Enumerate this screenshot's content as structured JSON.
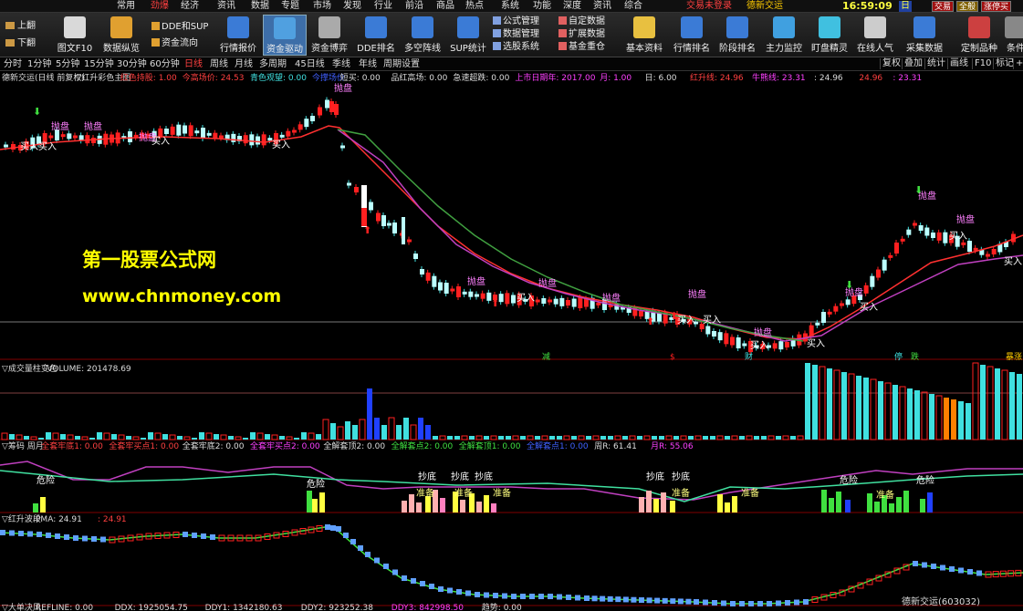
{
  "menu": {
    "items": [
      "常用",
      "劲爆",
      "经济",
      "资讯",
      "数据",
      "专题",
      "市场",
      "发现",
      "行业",
      "前沿",
      "商品",
      "热点",
      "系统",
      "功能",
      "深度",
      "资讯",
      "综合"
    ],
    "active": "劲爆",
    "status_red": "交易未登录",
    "status_gold": "德新交运",
    "clock": "16:59:09",
    "day": "日",
    "right_buttons": [
      "交易",
      "全般",
      "涨停买"
    ]
  },
  "toolbar": {
    "side_buttons": [
      "上翻",
      "下翻"
    ],
    "buttons": [
      {
        "label": "图文F10",
        "color": "#d9d9d9"
      },
      {
        "label": "数据纵览",
        "color": "#e0a030"
      },
      {
        "label": "行情报价",
        "color": "#3b7bd6"
      },
      {
        "label": "资金驱动",
        "color": "#50a0e0"
      },
      {
        "label": "资金博弈",
        "color": "#aaaaaa"
      },
      {
        "label": "DDE排名",
        "color": "#3b7bd6"
      },
      {
        "label": "多空阵线",
        "color": "#3b7bd6"
      },
      {
        "label": "SUP统计",
        "color": "#3b7bd6"
      },
      {
        "label": "基本资料",
        "color": "#e8c040"
      },
      {
        "label": "行情排名",
        "color": "#3b7bd6"
      },
      {
        "label": "阶段排名",
        "color": "#3b7bd6"
      },
      {
        "label": "主力监控",
        "color": "#40a0e0"
      },
      {
        "label": "盯盘精灵",
        "color": "#40c0e0"
      },
      {
        "label": "在线人气",
        "color": "#cccccc"
      },
      {
        "label": "采集数据",
        "color": "#3b7bd6"
      },
      {
        "label": "定制品种",
        "color": "#cc4040"
      },
      {
        "label": "条件",
        "color": "#888888"
      }
    ],
    "selected": "资金驱动",
    "mini_left": [
      "DDE和SUP",
      "资金流向"
    ],
    "mini_right_a": [
      "公式管理",
      "数据管理",
      "选股系统"
    ],
    "mini_right_b": [
      "自定数据",
      "扩展数据",
      "基金重仓"
    ]
  },
  "periods": {
    "items": [
      "分时",
      "1分钟",
      "5分钟",
      "15分钟",
      "30分钟",
      "60分钟",
      "日线",
      "周线",
      "月线",
      "多周期",
      "45日线",
      "季线",
      "年线",
      "周期设置"
    ],
    "active": "日线",
    "right": [
      "复权",
      "叠加",
      "统计",
      "画线",
      "F10",
      "标记",
      "+自"
    ]
  },
  "main_header": [
    {
      "t": "德新交运(日线 前复权)",
      "c": "#dddddd"
    },
    {
      "t": "▽红升彩色主图",
      "c": "#dddddd"
    },
    {
      "t": "红色持股: 1.00",
      "c": "#ff4040"
    },
    {
      "t": "今高场价: 24.53",
      "c": "#ff4040"
    },
    {
      "t": "青色观望: 0.00",
      "c": "#40e0e0"
    },
    {
      "t": "今撑场价",
      "c": "#4060ff"
    },
    {
      "t": "短买: 0.00",
      "c": "#dddddd"
    },
    {
      "t": "品红高场: 0.00",
      "c": "#dddddd"
    },
    {
      "t": "急速超跌: 0.00",
      "c": "#dddddd"
    },
    {
      "t": "上市日期年: 2017.00",
      "c": "#ff40ff"
    },
    {
      "t": "月: 1.00",
      "c": "#ff40ff"
    },
    {
      "t": "日: 6.00",
      "c": "#dddddd"
    },
    {
      "t": "红升线: 24.96",
      "c": "#ff4040"
    },
    {
      "t": "牛熊线: 23.31",
      "c": "#ff40ff"
    },
    {
      "t": ": 24.96",
      "c": "#dddddd"
    },
    {
      "t": "24.96",
      "c": "#ff4040"
    },
    {
      "t": ": 23.31",
      "c": "#ff40ff"
    }
  ],
  "watermark": {
    "line1": "第一股票公式网",
    "line2": "www.chnmoney.com"
  },
  "main_labels": {
    "sell": "抛盘",
    "buy": "买入",
    "shortsell": "减",
    "bottom_markers": [
      "减",
      "$",
      "财",
      "停",
      "跌",
      "暴涨"
    ]
  },
  "volume_header": [
    {
      "t": "▽成交量柱变色",
      "c": "#dddddd"
    },
    {
      "t": "VOLUME: 201478.69",
      "c": "#dddddd"
    }
  ],
  "chips_header": [
    {
      "t": "▽筹码 周月",
      "c": "#dddddd"
    },
    {
      "t": "全套牢底1: 0.00",
      "c": "#ff4040"
    },
    {
      "t": "全套牢买点1: 0.00",
      "c": "#ff4040"
    },
    {
      "t": "全套牢底2: 0.00",
      "c": "#dddddd"
    },
    {
      "t": "全套牢买点2: 0.00",
      "c": "#ff40ff"
    },
    {
      "t": "全解套顶2: 0.00",
      "c": "#dddddd"
    },
    {
      "t": "全解套点2: 0.00",
      "c": "#40e040"
    },
    {
      "t": "全解套顶1: 0.00",
      "c": "#40e040"
    },
    {
      "t": "全解套点1: 0.00",
      "c": "#4060ff"
    },
    {
      "t": "周R: 61.41",
      "c": "#dddddd"
    },
    {
      "t": "月R: 55.06",
      "c": "#ff40ff"
    }
  ],
  "chips_labels": {
    "danger": "危险",
    "bottom": "抄底",
    "prepare": "准备"
  },
  "wave_header": [
    {
      "t": "▽红升波段",
      "c": "#dddddd"
    },
    {
      "t": "PMA: 24.91",
      "c": "#dddddd"
    },
    {
      "t": ": 24.91",
      "c": "#ff4040"
    }
  ],
  "bottom_header": [
    {
      "t": "▽大单决风",
      "c": "#dddddd"
    },
    {
      "t": "REFLINE: 0.00",
      "c": "#dddddd"
    },
    {
      "t": "DDX: 1925054.75",
      "c": "#dddddd"
    },
    {
      "t": "DDY1: 1342180.63",
      "c": "#dddddd"
    },
    {
      "t": "DDY2: 923252.38",
      "c": "#dddddd"
    },
    {
      "t": "DDY3: 842998.50",
      "c": "#ff40ff"
    },
    {
      "t": "趋势: 0.00",
      "c": "#dddddd"
    }
  ],
  "stock_name": "德新交运(603032)",
  "colors": {
    "up": "#ff2020",
    "down": "#40e0e0",
    "ma1": "#ff3030",
    "ma2": "#c040c0",
    "ma3": "#40a040"
  }
}
